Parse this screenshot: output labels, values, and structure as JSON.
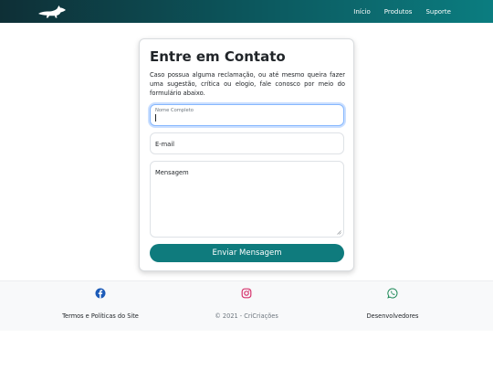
{
  "navbar": {
    "logo_icon": "dog-logo-icon",
    "links": [
      "Início",
      "Produtos",
      "Suporte"
    ],
    "background_colors": [
      "#0e2f36",
      "#0b7d80"
    ]
  },
  "contact_card": {
    "title": "Entre em Contato",
    "description": "Caso possua alguma reclamação, ou até mesmo queira fazer uma sugestão, crítica ou elogio, fale conosco por meio do formulário abaixo.",
    "fields": {
      "name": {
        "label": "Nome Completo",
        "value": "",
        "focused": true
      },
      "email": {
        "label": "E-mail",
        "value": ""
      },
      "message": {
        "label": "Mensagem",
        "value": ""
      }
    },
    "submit_label": "Enviar Mensagem",
    "accent_color": "#0f7b7d"
  },
  "footer": {
    "social_icons": [
      "facebook-icon",
      "instagram-icon",
      "whatsapp-icon"
    ],
    "social_colors": {
      "facebook": "#1c5bb8",
      "instagram": "#d6336c",
      "whatsapp": "#198754"
    },
    "terms_link": "Termos e Políticas do Site",
    "copyright": "© 2021 - CriCriações",
    "developers_link": "Desenvolvedores"
  }
}
